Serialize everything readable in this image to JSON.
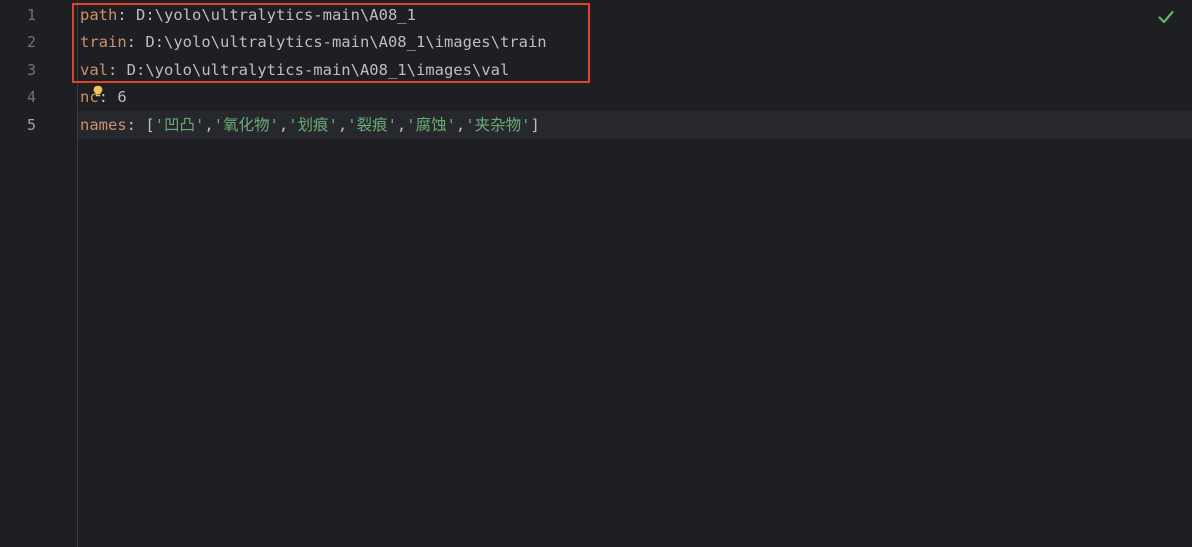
{
  "editor": {
    "line_numbers": [
      "1",
      "2",
      "3",
      "4",
      "5"
    ],
    "current_line": 5,
    "lines": [
      {
        "key": "path",
        "colon": ": ",
        "value": "D:\\yolo\\ultralytics-main\\A08_1"
      },
      {
        "key": "train",
        "colon": ": ",
        "value": "D:\\yolo\\ultralytics-main\\A08_1\\images\\train"
      },
      {
        "key": "val",
        "colon": ": ",
        "value": "D:\\yolo\\ultralytics-main\\A08_1\\images\\val"
      },
      {
        "key": "nc",
        "colon": ": ",
        "value": "6"
      },
      {
        "key": "names",
        "colon": ": ",
        "open": "[",
        "close": "]",
        "sep": ",",
        "items": [
          "'凹凸'",
          "'氧化物'",
          "'划痕'",
          "'裂痕'",
          "'腐蚀'",
          "'夹杂物'"
        ]
      }
    ]
  },
  "icons": {
    "bulb": "lightbulb-icon",
    "check": "check-icon"
  },
  "colors": {
    "background": "#1e1f22",
    "key": "#cf8e6d",
    "string": "#6aab73",
    "highlight_box": "#e0432b",
    "check": "#5fb865"
  }
}
